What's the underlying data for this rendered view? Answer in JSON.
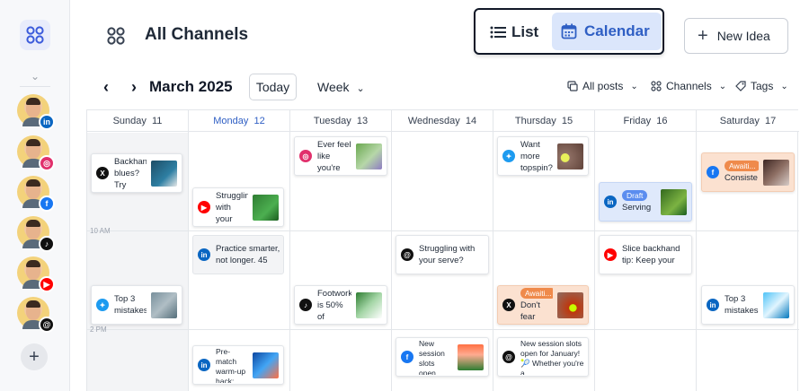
{
  "header": {
    "title": "All Channels",
    "view_list_label": "List",
    "view_calendar_label": "Calendar",
    "active_view": "Calendar",
    "new_idea_label": "New Idea"
  },
  "sidebar": {
    "channels": [
      {
        "network": "linkedin",
        "badge_glyph": "in",
        "color": "#0a66c2"
      },
      {
        "network": "instagram",
        "badge_glyph": "◎",
        "color": "#e1306c"
      },
      {
        "network": "facebook",
        "badge_glyph": "f",
        "color": "#1877f2"
      },
      {
        "network": "tiktok",
        "badge_glyph": "♪",
        "color": "#111111"
      },
      {
        "network": "youtube",
        "badge_glyph": "▶",
        "color": "#ff0000"
      },
      {
        "network": "threads",
        "badge_glyph": "@",
        "color": "#111111"
      }
    ],
    "add_label": "+"
  },
  "toolbar": {
    "month": "March 2025",
    "today_label": "Today",
    "range_label": "Week",
    "filters": [
      {
        "label": "All posts",
        "icon": "posts-icon"
      },
      {
        "label": "Channels",
        "icon": "channels-icon"
      },
      {
        "label": "Tags",
        "icon": "tag-icon"
      }
    ]
  },
  "calendar": {
    "days": [
      {
        "name": "Sunday",
        "date": "11"
      },
      {
        "name": "Monday",
        "date": "12"
      },
      {
        "name": "Tuesday",
        "date": "13"
      },
      {
        "name": "Wednesday",
        "date": "14"
      },
      {
        "name": "Thursday",
        "date": "15"
      },
      {
        "name": "Friday",
        "date": "16"
      },
      {
        "name": "Saturday",
        "date": "17"
      }
    ],
    "today_index": 1,
    "time_labels": [
      "10 AM",
      "2 PM"
    ],
    "posts": [
      {
        "day": "Sunday",
        "network": "x",
        "text": "Backhand blues? Try",
        "status": ""
      },
      {
        "day": "Monday",
        "network": "youtube",
        "text": "Struggling with your",
        "status": ""
      },
      {
        "day": "Tuesday",
        "network": "instagram",
        "text": "Ever feel like you're",
        "status": ""
      },
      {
        "day": "Thursday",
        "network": "bluesky",
        "text": "Want more topspin?",
        "status": ""
      },
      {
        "day": "Saturday",
        "network": "facebook",
        "text": "Consiste",
        "status": "Awaiti..."
      },
      {
        "day": "Friday",
        "network": "linkedin",
        "text": "Serving",
        "status": "Draft"
      },
      {
        "day": "Monday",
        "network": "linkedin",
        "text": "Practice smarter, not longer. 45",
        "status": ""
      },
      {
        "day": "Wednesday",
        "network": "threads",
        "text": "Struggling with your serve?",
        "status": ""
      },
      {
        "day": "Friday",
        "network": "youtube",
        "text": "Slice backhand tip: Keep your",
        "status": ""
      },
      {
        "day": "Sunday",
        "network": "bluesky",
        "text": "Top 3 mistakes",
        "status": ""
      },
      {
        "day": "Tuesday",
        "network": "tiktok",
        "text": "Footwork is 50% of",
        "status": ""
      },
      {
        "day": "Thursday",
        "network": "x",
        "text": "Don't fear",
        "status": "Awaiti..."
      },
      {
        "day": "Saturday",
        "network": "linkedin",
        "text": "Top 3 mistakes",
        "status": ""
      },
      {
        "day": "Monday",
        "network": "linkedin",
        "text": "Pre-match warm-up hack: Don't",
        "status": ""
      },
      {
        "day": "Wednesday",
        "network": "facebook",
        "text": "New session slots open",
        "status": ""
      },
      {
        "day": "Thursday",
        "network": "threads",
        "text": "New session slots open for January! 🎾 Whether you're a",
        "status": ""
      }
    ]
  },
  "colors": {
    "accent": "#2f5fc4",
    "accent_bg": "#dbe6fb",
    "draft_bg": "#dfe9fb",
    "awaiting_bg": "#fbe1d0"
  }
}
